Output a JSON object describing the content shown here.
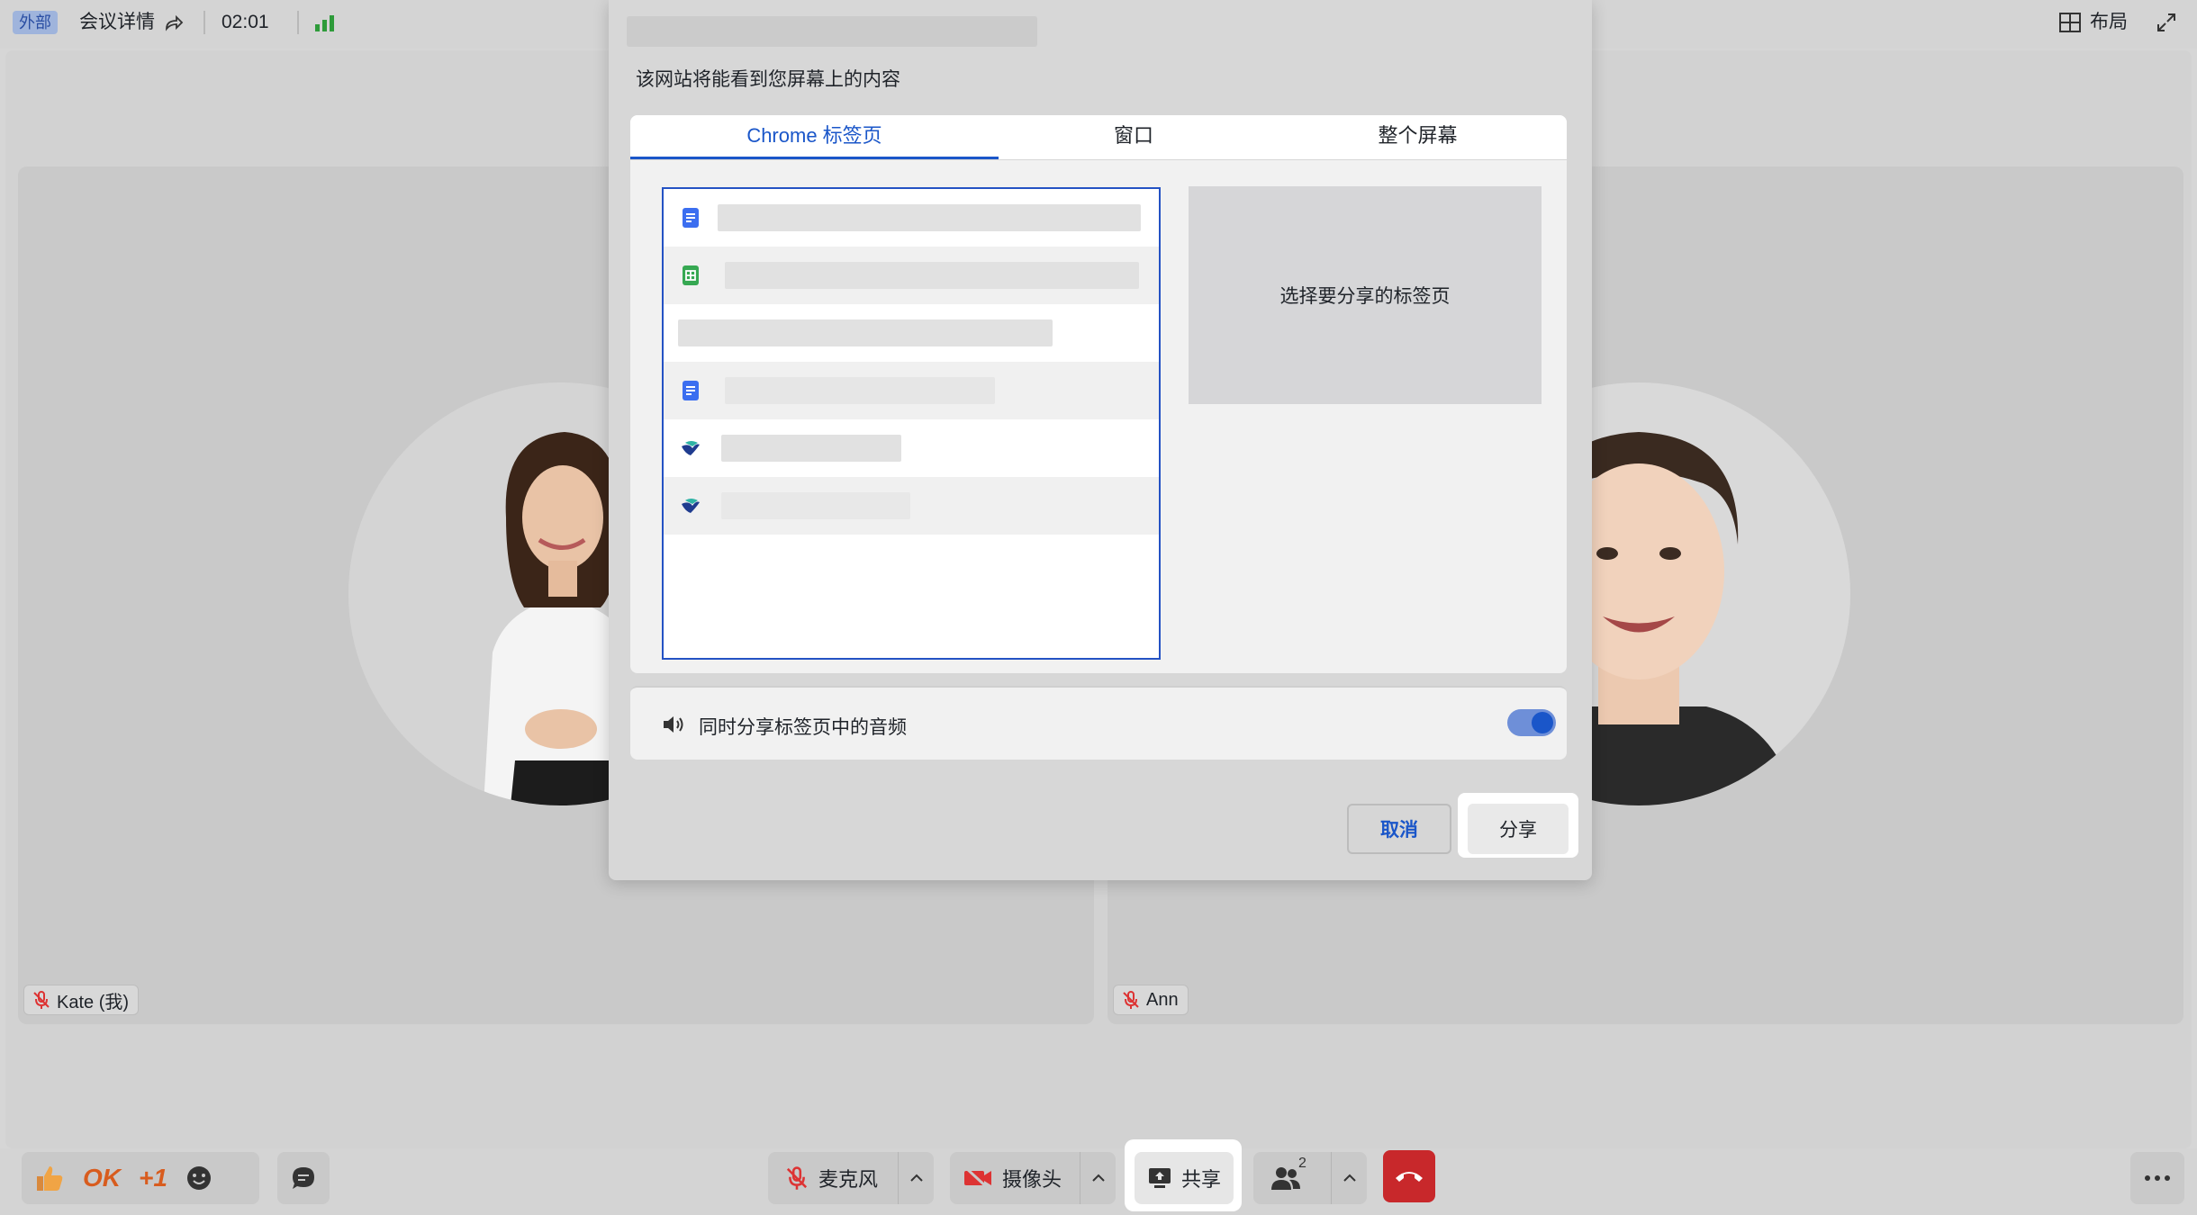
{
  "topbar": {
    "external_tag": "外部",
    "meeting_details": "会议详情",
    "timer": "02:01",
    "layout_label": "布局"
  },
  "participants": [
    {
      "name": "Kate (我)",
      "muted": true
    },
    {
      "name": "Ann",
      "muted": true
    }
  ],
  "bottombar": {
    "reactions": [
      "OK",
      "+1"
    ],
    "mic_label": "麦克风",
    "camera_label": "摄像头",
    "share_label": "共享",
    "participant_count": "2"
  },
  "dialog": {
    "subtitle": "该网站将能看到您屏幕上的内容",
    "tabs": [
      "Chrome 标签页",
      "窗口",
      "整个屏幕"
    ],
    "active_tab": 0,
    "tab_items": [
      {
        "icon": "google-docs-icon"
      },
      {
        "icon": "google-sheets-icon"
      },
      {
        "icon": "none"
      },
      {
        "icon": "google-docs-icon"
      },
      {
        "icon": "bird-app-icon"
      },
      {
        "icon": "bird-app-icon"
      }
    ],
    "preview_placeholder": "选择要分享的标签页",
    "audio_label": "同时分享标签页中的音频",
    "audio_enabled": true,
    "cancel_label": "取消",
    "share_label": "分享"
  },
  "colors": {
    "accent": "#1a56c9",
    "hangup": "#c8282b",
    "reaction": "#d85c1e"
  }
}
